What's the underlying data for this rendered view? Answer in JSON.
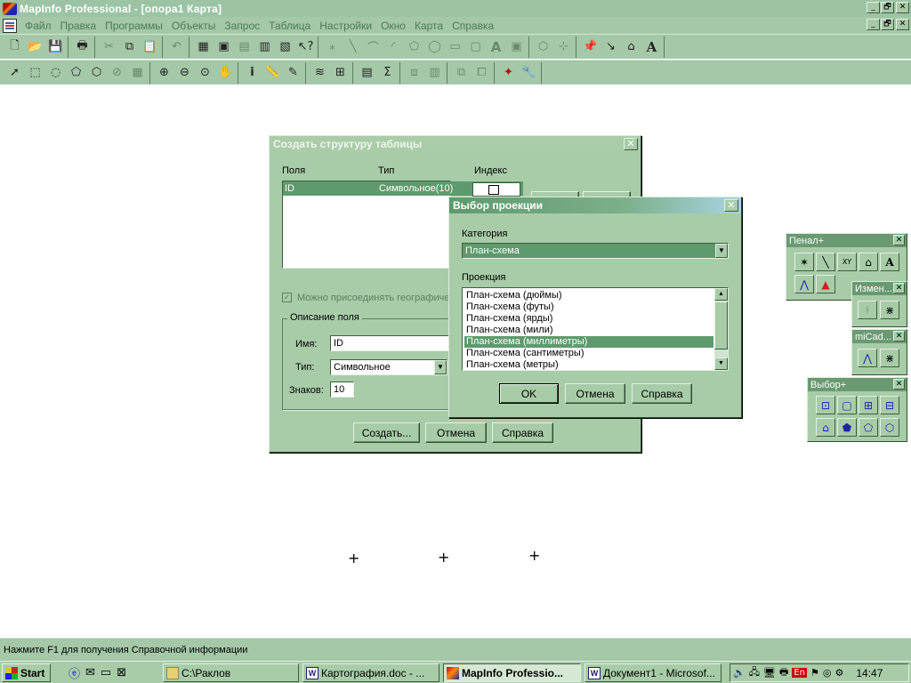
{
  "window": {
    "title": "MapInfo Professional - [опора1 Карта]",
    "controls": [
      "_",
      "🗗",
      "✕"
    ]
  },
  "menu": [
    "Файл",
    "Правка",
    "Программы",
    "Объекты",
    "Запрос",
    "Таблица",
    "Настройки",
    "Окно",
    "Карта",
    "Справка"
  ],
  "toolbars": {
    "standard": [
      "new-icon",
      "open-icon",
      "save-icon",
      "print-icon",
      "cut-icon",
      "copy-icon",
      "paste-icon",
      "undo-icon",
      "new-browser-icon",
      "new-map-icon",
      "new-graph-icon",
      "new-layout-icon",
      "new-redistrict-icon",
      "help-pointer-icon"
    ],
    "drawing": [
      "symbol-icon",
      "line-icon",
      "polyline-icon",
      "arc-icon",
      "polygon-icon",
      "ellipse-icon",
      "rectangle-icon",
      "rounded-rect-icon",
      "text-icon",
      "frame-icon",
      "reshape-icon",
      "add-node-icon",
      "pin-icon",
      "measure-icon",
      "house-icon",
      "text-style-icon"
    ],
    "main": [
      "pointer-icon",
      "marquee-select-icon",
      "radius-select-icon",
      "polygon-select-icon",
      "boundary-select-icon",
      "unselect-icon",
      "graph-select-icon",
      "zoom-in-icon",
      "zoom-out-icon",
      "change-view-icon",
      "grabber-icon",
      "info-icon",
      "ruler-icon",
      "label-icon",
      "layer-control-icon",
      "legend-icon",
      "statistics-icon",
      "sigma-icon",
      "drag-map-icon",
      "thematic-icon",
      "clip-region-icon",
      "hotlink-icon",
      "tool-manager-icon",
      "wrench-icon"
    ]
  },
  "dialog_structure": {
    "title": "Создать структуру таблицы",
    "col_fields": "Поля",
    "col_type": "Тип",
    "col_index": "Индекс",
    "row": {
      "name": "ID",
      "type": "Символьное(10)"
    },
    "attach_geo": "Можно присоединять географические объекты",
    "group_label": "Описание поля",
    "name_label": "Имя:",
    "name_value": "ID",
    "type_label": "Тип:",
    "type_value": "Символьное",
    "chars_label": "Знаков:",
    "chars_value": "10",
    "btn_create": "Создать...",
    "btn_cancel": "Отмена",
    "btn_help": "Справка"
  },
  "dialog_projection": {
    "title": "Выбор проекции",
    "category_label": "Категория",
    "category_value": "План-схема",
    "projection_label": "Проекция",
    "projections": [
      "План-схема (дюймы)",
      "План-схема (футы)",
      "План-схема (ярды)",
      "План-схема (мили)",
      "План-схема (миллиметры)",
      "План-схема (сантиметры)",
      "План-схема (метры)"
    ],
    "selected_index": 4,
    "btn_ok": "OK",
    "btn_cancel": "Отмена",
    "btn_help": "Справка"
  },
  "palettes": {
    "penal": {
      "title": "Пенал+"
    },
    "izmen": {
      "title": "Измен..."
    },
    "micad": {
      "title": "miCad..."
    },
    "vybor": {
      "title": "Выбор+"
    }
  },
  "statusbar": {
    "text": "Нажмите F1 для получения Справочной информации"
  },
  "taskbar": {
    "start": "Start",
    "tasks": [
      "C:\\Раклов",
      "Картография.doc - ...",
      "MapInfo Professio...",
      "Документ1 - Microsof..."
    ],
    "active_task": 2,
    "lang": "En",
    "clock": "14:47"
  },
  "colors": {
    "accent": "#5e9a6c",
    "face": "#a8cca8",
    "selection": "#5e9a6c"
  }
}
